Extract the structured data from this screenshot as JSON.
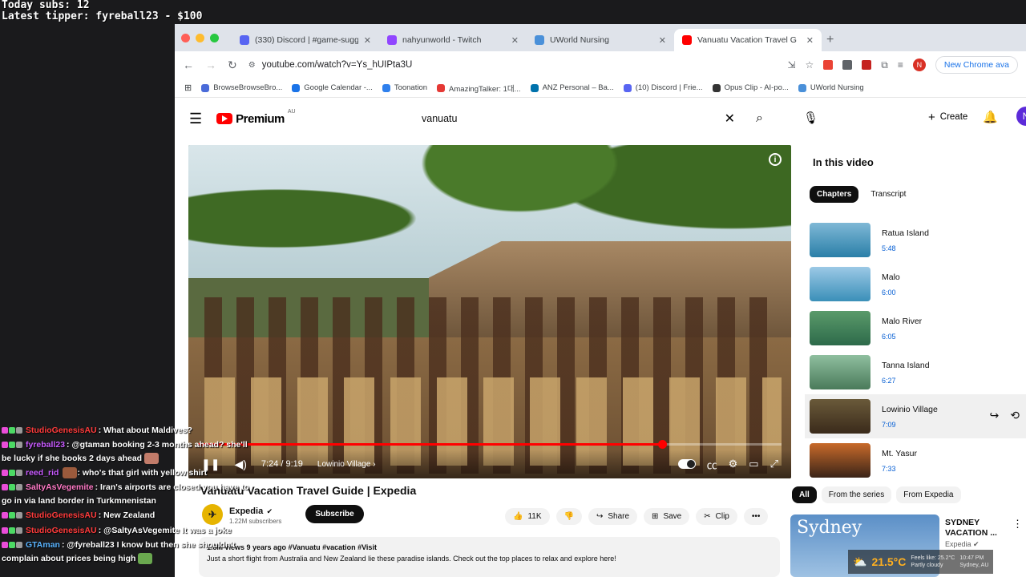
{
  "overlay": {
    "today_subs": "Today subs: 12",
    "latest_tipper": "Latest tipper: fyreball23 - $100"
  },
  "chat": [
    {
      "user": "StudioGenesisAU",
      "user_color": "#ff3b3b",
      "text": ": What about Maldives?"
    },
    {
      "user": "fyreball23",
      "user_color": "#c85aff",
      "text": ": @gtaman booking 2-3 months ahead? she'll be lucky if she books 2 days ahead"
    },
    {
      "user": "reed_rid",
      "user_color": "#c85aff",
      "text": ": who's that girl with yellow shirt"
    },
    {
      "user": "SaltyAsVegemite",
      "user_color": "#ff79c6",
      "text": ": Iran's airports are closed you have to go in via land border in Turkmnenistan"
    },
    {
      "user": "StudioGenesisAU",
      "user_color": "#ff3b3b",
      "text": ": New Zealand"
    },
    {
      "user": "StudioGenesisAU",
      "user_color": "#ff3b3b",
      "text": ": @SaltyAsVegemite It was a joke"
    },
    {
      "user": "GTAman",
      "user_color": "#5ab4ff",
      "text": ": @fyreball23 I know but then she shouldn't complain about prices being high"
    }
  ],
  "browser": {
    "tabs": [
      {
        "title": "(330) Discord | #game-sugg",
        "color": "#5865f2"
      },
      {
        "title": "nahyunworld - Twitch",
        "color": "#9146ff"
      },
      {
        "title": "UWorld Nursing",
        "color": "#4a90d9"
      },
      {
        "title": "Vanuatu Vacation Travel G",
        "color": "#ff0000"
      }
    ],
    "url": "youtube.com/watch?v=Ys_hUIPta3U",
    "new_chrome": "New Chrome ava",
    "profile_initial": "N",
    "bookmarks": [
      {
        "label": "BrowseBrowseBro...",
        "color": "#4a6bd9"
      },
      {
        "label": "Google Calendar -...",
        "color": "#1a73e8"
      },
      {
        "label": "Toonation",
        "color": "#2f80ed"
      },
      {
        "label": "AmazingTalker: 1대...",
        "color": "#e53935"
      },
      {
        "label": "ANZ Personal – Ba...",
        "color": "#0072ac"
      },
      {
        "label": "(10) Discord | Frie...",
        "color": "#5865f2"
      },
      {
        "label": "Opus Clip - AI-po...",
        "color": "#333333"
      },
      {
        "label": "UWorld Nursing",
        "color": "#4a90d9"
      }
    ]
  },
  "youtube": {
    "brand": "Premium",
    "region": "AU",
    "search_query": "vanuatu",
    "create_label": "Create",
    "avatar_initial": "N",
    "player": {
      "time": "7:24 / 9:19",
      "chapter": "Lowinio Village",
      "progress": 0.795
    },
    "title": "Vanuatu Vacation Travel Guide | Expedia",
    "channel": "Expedia",
    "subscribers": "1.22M subscribers",
    "subscribe_label": "Subscribe",
    "likes": "11K",
    "share_label": "Share",
    "save_label": "Save",
    "clip_label": "Clip",
    "description_meta": "1.8M views  9 years ago  #Vanuatu #vacation #Visit",
    "description_text": "Just a short flight from Australia and New Zealand lie these paradise islands. Check out the top places to relax and explore here!",
    "sidebar": {
      "heading": "In this video",
      "tab_chapters": "Chapters",
      "tab_transcript": "Transcript",
      "chapters": [
        {
          "title": "Ratua Island",
          "time": "5:48",
          "colors": [
            "#7fb8d6",
            "#2a7fa8"
          ]
        },
        {
          "title": "Malo",
          "time": "6:00",
          "colors": [
            "#9cc9e6",
            "#3a8fb8"
          ]
        },
        {
          "title": "Malo River",
          "time": "6:05",
          "colors": [
            "#5a9a6a",
            "#2d6a4a"
          ]
        },
        {
          "title": "Tanna Island",
          "time": "6:27",
          "colors": [
            "#8fbf9f",
            "#4a7a5a"
          ]
        },
        {
          "title": "Lowinio Village",
          "time": "7:09",
          "colors": [
            "#6a5a3a",
            "#3a2a1a"
          ]
        },
        {
          "title": "Mt. Yasur",
          "time": "7:33",
          "colors": [
            "#c86a2a",
            "#3a2418"
          ]
        }
      ],
      "filters": [
        "All",
        "From the series",
        "From Expedia"
      ],
      "recommendation": {
        "thumb_text": "Sydney",
        "title": "SYDNEY VACATION ...",
        "channel": "Expedia"
      }
    }
  },
  "weather": {
    "temp": "21.5°C",
    "feels": "Feels like: 25.2°C",
    "condition": "Partly cloudy",
    "time": "10:47 PM",
    "place": "Sydney, AU"
  }
}
